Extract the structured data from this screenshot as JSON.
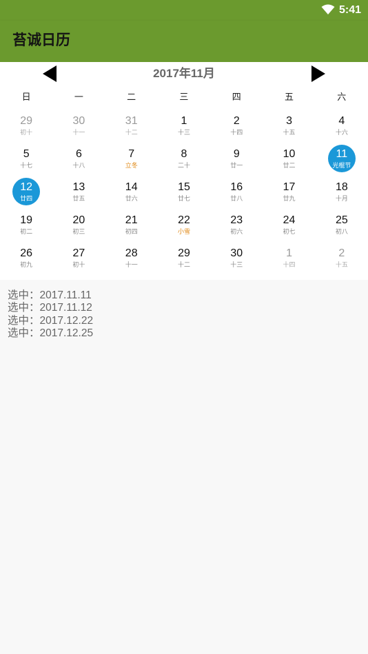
{
  "status": {
    "time": "5:41"
  },
  "app": {
    "title": "苔诚日历"
  },
  "calendar": {
    "month_title": "2017年11月",
    "weekdays": [
      "日",
      "一",
      "二",
      "三",
      "四",
      "五",
      "六"
    ],
    "days": [
      {
        "num": "29",
        "lunar": "初十",
        "state": "other"
      },
      {
        "num": "30",
        "lunar": "十一",
        "state": "other"
      },
      {
        "num": "31",
        "lunar": "十二",
        "state": "other"
      },
      {
        "num": "1",
        "lunar": "十三",
        "state": "normal"
      },
      {
        "num": "2",
        "lunar": "十四",
        "state": "normal"
      },
      {
        "num": "3",
        "lunar": "十五",
        "state": "normal"
      },
      {
        "num": "4",
        "lunar": "十六",
        "state": "normal"
      },
      {
        "num": "5",
        "lunar": "十七",
        "state": "normal"
      },
      {
        "num": "6",
        "lunar": "十八",
        "state": "normal"
      },
      {
        "num": "7",
        "lunar": "立冬",
        "state": "term"
      },
      {
        "num": "8",
        "lunar": "二十",
        "state": "normal"
      },
      {
        "num": "9",
        "lunar": "廿一",
        "state": "normal"
      },
      {
        "num": "10",
        "lunar": "廿二",
        "state": "normal"
      },
      {
        "num": "11",
        "lunar": "光棍节",
        "state": "selected"
      },
      {
        "num": "12",
        "lunar": "廿四",
        "state": "selected"
      },
      {
        "num": "13",
        "lunar": "廿五",
        "state": "normal"
      },
      {
        "num": "14",
        "lunar": "廿六",
        "state": "normal"
      },
      {
        "num": "15",
        "lunar": "廿七",
        "state": "normal"
      },
      {
        "num": "16",
        "lunar": "廿八",
        "state": "normal"
      },
      {
        "num": "17",
        "lunar": "廿九",
        "state": "normal"
      },
      {
        "num": "18",
        "lunar": "十月",
        "state": "normal"
      },
      {
        "num": "19",
        "lunar": "初二",
        "state": "normal"
      },
      {
        "num": "20",
        "lunar": "初三",
        "state": "normal"
      },
      {
        "num": "21",
        "lunar": "初四",
        "state": "normal"
      },
      {
        "num": "22",
        "lunar": "小雪",
        "state": "term"
      },
      {
        "num": "23",
        "lunar": "初六",
        "state": "normal"
      },
      {
        "num": "24",
        "lunar": "初七",
        "state": "normal"
      },
      {
        "num": "25",
        "lunar": "初八",
        "state": "normal"
      },
      {
        "num": "26",
        "lunar": "初九",
        "state": "normal"
      },
      {
        "num": "27",
        "lunar": "初十",
        "state": "normal"
      },
      {
        "num": "28",
        "lunar": "十一",
        "state": "normal"
      },
      {
        "num": "29",
        "lunar": "十二",
        "state": "normal"
      },
      {
        "num": "30",
        "lunar": "十三",
        "state": "normal"
      },
      {
        "num": "1",
        "lunar": "十四",
        "state": "other"
      },
      {
        "num": "2",
        "lunar": "十五",
        "state": "other"
      }
    ]
  },
  "selections": [
    "选中：2017.11.11",
    "选中：2017.11.12",
    "选中：2017.12.22",
    "选中：2017.12.25"
  ],
  "icons": {
    "prev": "triangle-left-icon",
    "next": "triangle-right-icon",
    "wifi": "wifi-icon"
  },
  "colors": {
    "app_bar": "#6b9a2e",
    "selected": "#1b98d8",
    "solar_term": "#e08a17",
    "background": "#f8f8f8"
  }
}
